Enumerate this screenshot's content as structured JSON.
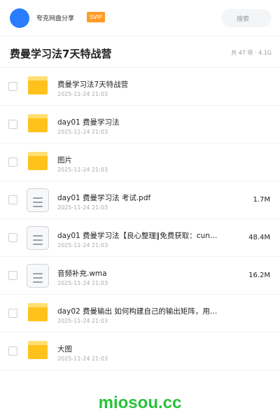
{
  "header": {
    "username": "夸克网盘分享",
    "vip_badge": "SVIP",
    "search_placeholder": "搜索"
  },
  "folder": {
    "title": "费曼学习法7天特战营",
    "meta": "共 47 项 · 4.1G"
  },
  "files": [
    {
      "name": "费曼学习法7天特战营",
      "date": "2025-11-24 21:03",
      "size": "",
      "type": "folder-icon"
    },
    {
      "name": "day01 费曼学习法",
      "date": "2025-11-24 21:03",
      "size": "",
      "type": "folder-icon"
    },
    {
      "name": "图片",
      "date": "2025-11-24 21:03",
      "size": "",
      "type": "folder-icon"
    },
    {
      "name": "day01 费曼学习法 考试.pdf",
      "date": "2025-11-24 21:03",
      "size": "1.7M",
      "type": "document-icon"
    },
    {
      "name": "day01 费曼学习法【良心整理‖免费获取：cun…",
      "date": "2025-11-24 21:03",
      "size": "48.4M",
      "type": "document-icon"
    },
    {
      "name": "音频补充.wma",
      "date": "2025-11-24 21:03",
      "size": "16.2M",
      "type": "document-icon"
    },
    {
      "name": "day02 费曼输出 如何构建自己的输出矩阵，用…",
      "date": "2025-11-24 21:03",
      "size": "",
      "type": "folder-icon"
    },
    {
      "name": "大图",
      "date": "2025-11-24 21:03",
      "size": "",
      "type": "folder-icon"
    }
  ],
  "watermark": "miosou.cc",
  "colors": {
    "accent": "#2a7cff",
    "vip": "#ff9c28",
    "folder": "#ffc21d",
    "watermark": "#27c23a"
  }
}
